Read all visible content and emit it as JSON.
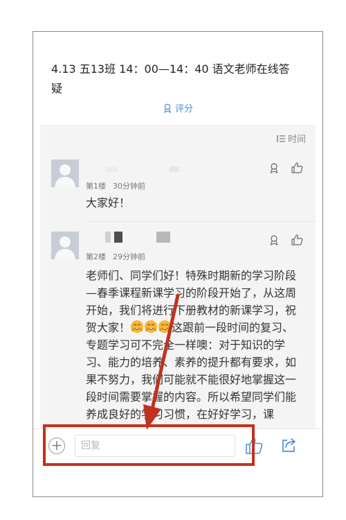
{
  "post": {
    "title": "4.13 五13班 14：00—14：40 语文老师在线答疑",
    "rate_label": "评分"
  },
  "sort": {
    "label": "时间"
  },
  "comments": [
    {
      "floor": "第1楼",
      "time": "30分钟前",
      "text": "大家好！"
    },
    {
      "floor": "第2楼",
      "time": "29分钟前",
      "text_parts": {
        "p1": "老师们、同学们好！特殊时期新的学习阶段—春季课程新课学习的阶段开始了，从这周开始，我们将进行下册教材的新课学习，祝贺大家！",
        "p2": "这跟前一段时间的复习、专题学习可不完全一样噢：对于知识的学习、能力的培养、素养的提升都有要求，如果不努力，我们可能就不能很好地掌握这一段时间需要掌握的内容。所以希望同学们能养成良好的学习习惯，在好好学习，课"
      }
    }
  ],
  "bottom_bar": {
    "plus_label": "+",
    "reply_placeholder": "回复"
  },
  "colors": {
    "accent": "#4a8fd6",
    "highlight_box": "#c0321f",
    "avatar": "#c7ccd6"
  }
}
